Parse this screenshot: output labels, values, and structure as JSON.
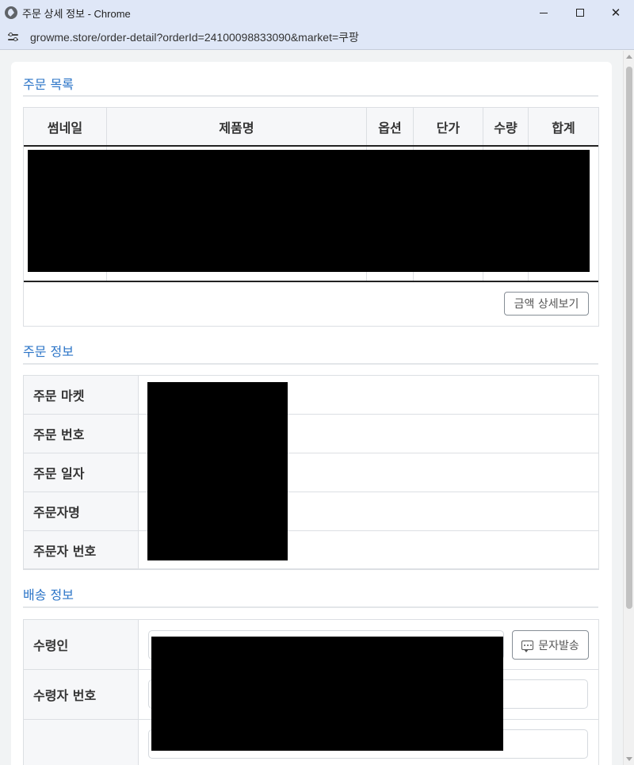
{
  "window": {
    "title": "주문 상세 정보 - Chrome",
    "url": "growme.store/order-detail?orderId=24100098833090&market=쿠팡"
  },
  "order_list": {
    "section_title": "주문 목록",
    "columns": [
      "썸네일",
      "제품명",
      "옵션",
      "단가",
      "수량",
      "합계"
    ],
    "amount_detail_button": "금액 상세보기"
  },
  "order_info": {
    "section_title": "주문 정보",
    "rows": [
      {
        "label": "주문 마켓"
      },
      {
        "label": "주문 번호"
      },
      {
        "label": "주문 일자"
      },
      {
        "label": "주문자명"
      },
      {
        "label": "주문자 번호"
      }
    ]
  },
  "shipping_info": {
    "section_title": "배송 정보",
    "rows": [
      {
        "label": "수령인"
      },
      {
        "label": "수령자 번호"
      },
      {
        "label": ""
      }
    ],
    "sms_button": "문자발송"
  }
}
